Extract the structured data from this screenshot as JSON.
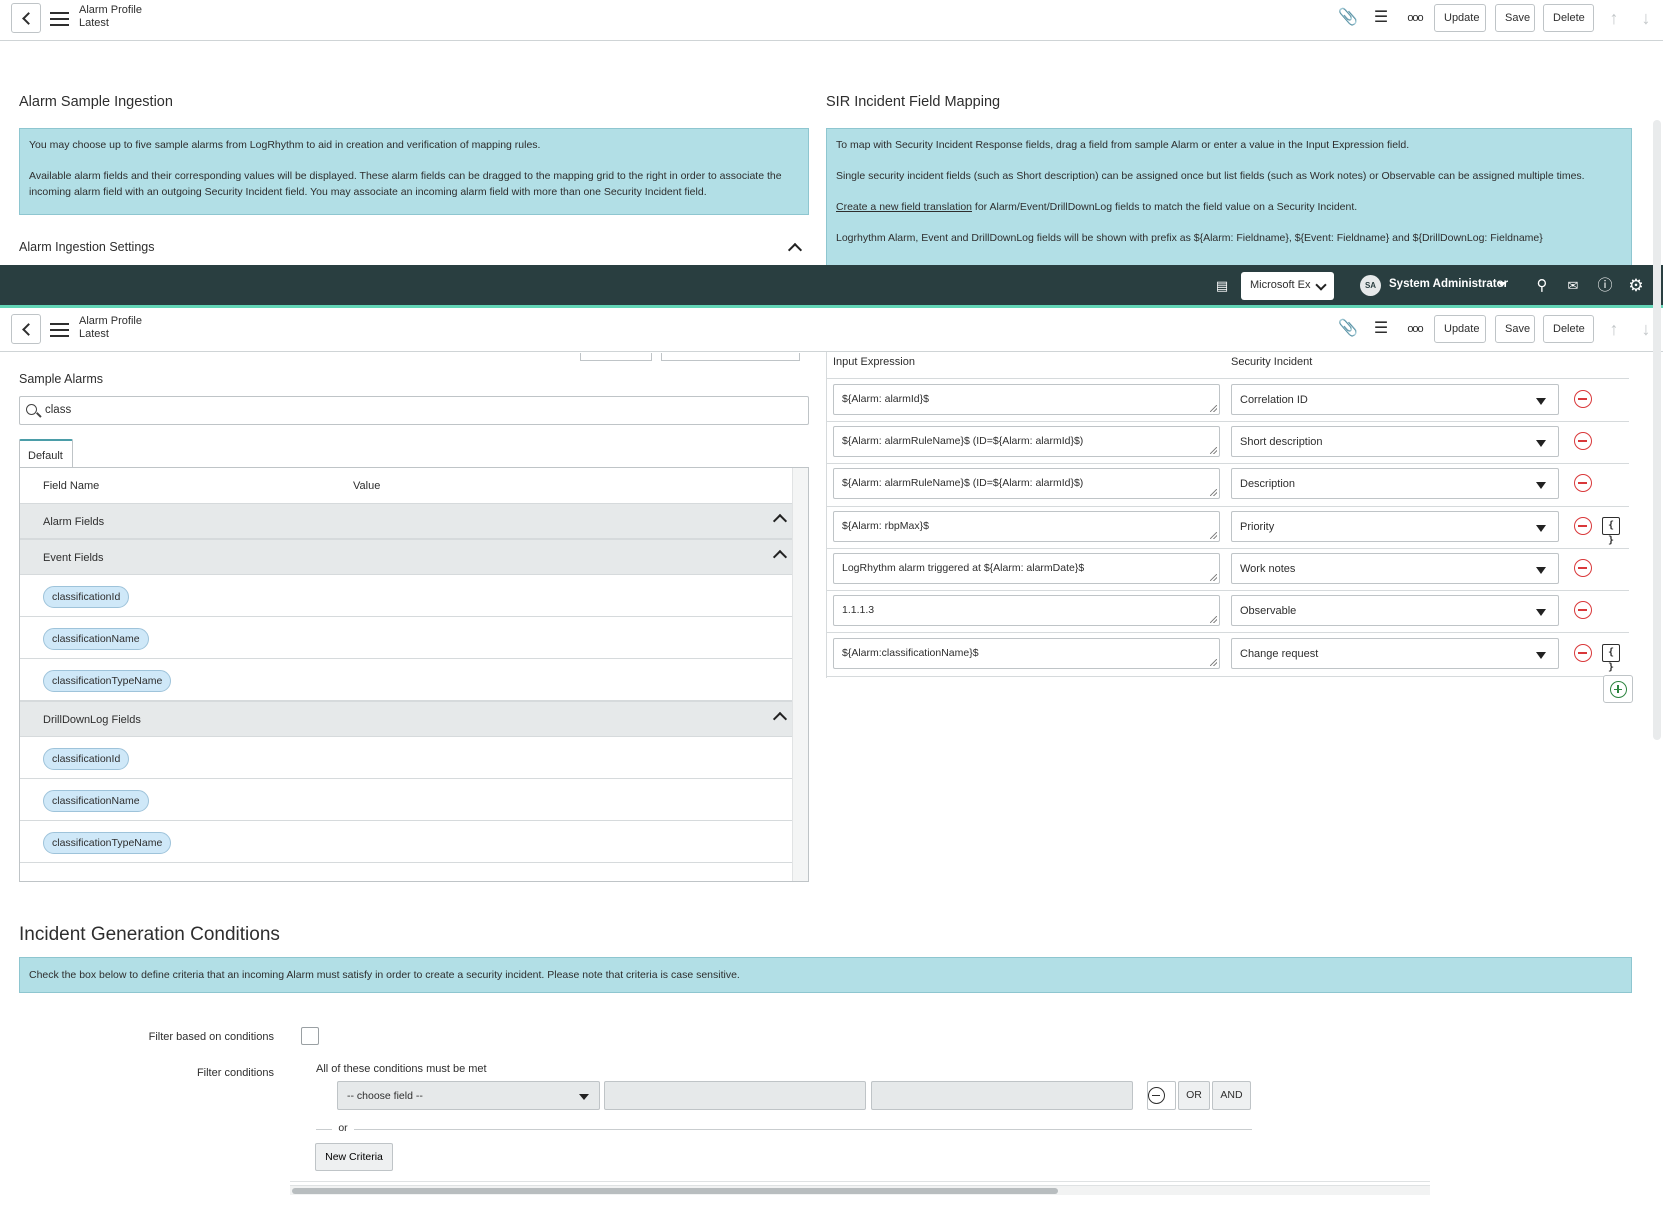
{
  "header": {
    "title_line1": "Alarm Profile",
    "title_line2": "Latest",
    "update_label": "Update",
    "save_label": "Save",
    "delete_label": "Delete"
  },
  "ingestion": {
    "title": "Alarm Sample Ingestion",
    "info_p1": "You may choose up to five sample alarms from LogRhythm to aid in creation and verification of mapping rules.",
    "info_p2": "Available alarm fields and their corresponding values will be displayed. These alarm fields can be dragged to the mapping grid to the right in order to associate the incoming alarm field with an outgoing Security Incident field. You may associate an incoming alarm field with more than one Security Incident field.",
    "settings_label": "Alarm Ingestion Settings"
  },
  "mapping": {
    "title": "SIR Incident Field Mapping",
    "info_p1": "To map with Security Incident Response fields, drag a field from sample Alarm or enter a value in the Input Expression field.",
    "info_p2": "Single security incident fields (such as Short description) can be assigned once but list fields (such as Work notes) or Observable can be assigned multiple times.",
    "info_p3_link": "Create a new field translation",
    "info_p3_rest": " for Alarm/Event/DrillDownLog fields to match the field value on a Security Incident.",
    "info_p4": "Logrhythm Alarm, Event and DrillDownLog fields will be shown with prefix as ${Alarm: Fieldname}, ${Event: Fieldname} and ${DrillDownLog: Fieldname}",
    "col_input": "Input Expression",
    "col_security": "Security Incident",
    "rows": [
      {
        "expr": "${Alarm: alarmId}$",
        "field": "Correlation ID"
      },
      {
        "expr": "${Alarm: alarmRuleName}$ (ID=${Alarm: alarmId}$)",
        "field": "Short description"
      },
      {
        "expr": "${Alarm: alarmRuleName}$ (ID=${Alarm: alarmId}$)",
        "field": "Description"
      },
      {
        "expr": "${Alarm: rbpMax}$",
        "field": "Priority"
      },
      {
        "expr": "LogRhythm alarm triggered at ${Alarm: alarmDate}$",
        "field": "Work notes"
      },
      {
        "expr": "1.1.1.3",
        "field": "Observable"
      },
      {
        "expr": "${Alarm:classificationName}$",
        "field": "Change request"
      }
    ],
    "brace_glyph": "{ }"
  },
  "navbar": {
    "scope_value": "Microsoft Ex",
    "avatar_initials": "SA",
    "user_name": "System Administrator"
  },
  "samples": {
    "title": "Sample Alarms",
    "search_value": "class",
    "tab_default": "Default",
    "col_field": "Field Name",
    "col_value": "Value",
    "group_alarm": "Alarm Fields",
    "group_event": "Event Fields",
    "group_drill": "DrillDownLog Fields",
    "event_fields": [
      "classificationId",
      "classificationName",
      "classificationTypeName"
    ],
    "drill_fields": [
      "classificationId",
      "classificationName",
      "classificationTypeName"
    ]
  },
  "conditions": {
    "title": "Incident Generation Conditions",
    "info": "Check the box below to define criteria that an incoming Alarm must satisfy in order to create a security incident. Please note that criteria is case sensitive.",
    "filter_label": "Filter based on conditions",
    "conditions_label": "Filter conditions",
    "all_met": "All of these conditions must be met",
    "choose_field": "-- choose field --",
    "or_label": "OR",
    "and_label": "AND",
    "or_divider": "or",
    "new_criteria": "New Criteria"
  },
  "colors": {
    "navbar_bg": "#293e40",
    "accent": "#62d5b6",
    "info_bg": "#b2dfe6",
    "remove_red": "#d9383a",
    "add_green": "#2e8540"
  }
}
